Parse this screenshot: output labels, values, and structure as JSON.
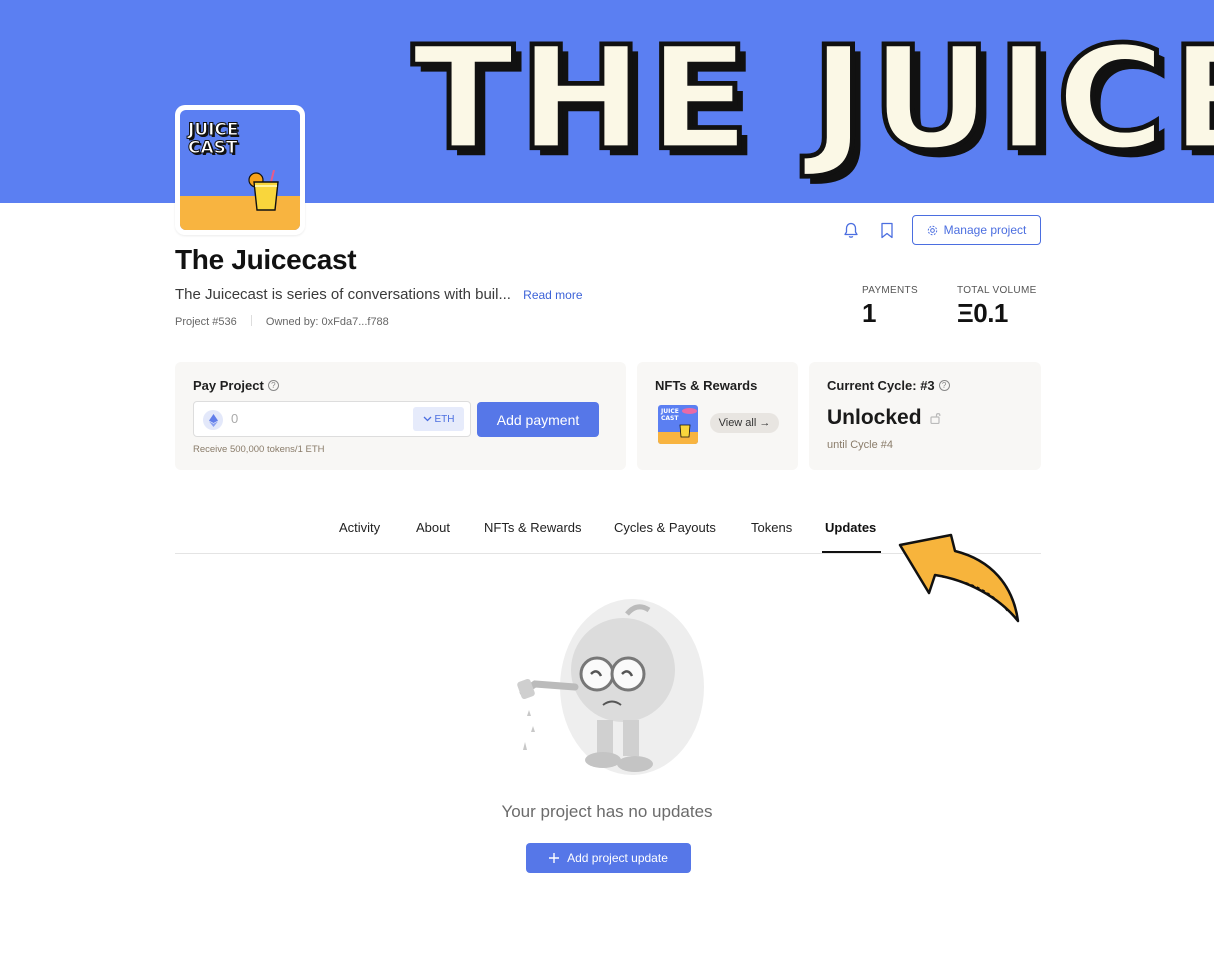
{
  "banner": {
    "text": "THE JUICECAST"
  },
  "logo": {
    "line1": "JUICE",
    "line2": "CAST"
  },
  "project": {
    "title": "The Juicecast",
    "description": "The Juicecast is series of conversations with buil...",
    "read_more": "Read more",
    "number": "Project #536",
    "owner": "Owned by: 0xFda7...f788"
  },
  "header_actions": {
    "notifications_icon": "bell-icon",
    "bookmark_icon": "bookmark-icon",
    "manage_label": "Manage project"
  },
  "stats": {
    "payments_label": "PAYMENTS",
    "payments_value": "1",
    "volume_label": "TOTAL VOLUME",
    "volume_value": "Ξ0.1"
  },
  "pay_card": {
    "title": "Pay Project",
    "input_value": "0",
    "currency": "ETH",
    "button": "Add payment",
    "hint": "Receive 500,000 tokens/1 ETH"
  },
  "nft_card": {
    "title": "NFTs & Rewards",
    "view_all": "View all →"
  },
  "cycle_card": {
    "title": "Current Cycle: #3",
    "status": "Unlocked",
    "until": "until Cycle #4"
  },
  "tabs": [
    {
      "label": "Activity"
    },
    {
      "label": "About"
    },
    {
      "label": "NFTs & Rewards"
    },
    {
      "label": "Cycles & Payouts"
    },
    {
      "label": "Tokens"
    },
    {
      "label": "Updates"
    }
  ],
  "active_tab": "Updates",
  "empty_state": {
    "message": "Your project has no updates",
    "button": "Add project update"
  },
  "colors": {
    "banner": "#5b7ff2",
    "accent": "#5677e8",
    "arrow": "#f7b43c"
  }
}
